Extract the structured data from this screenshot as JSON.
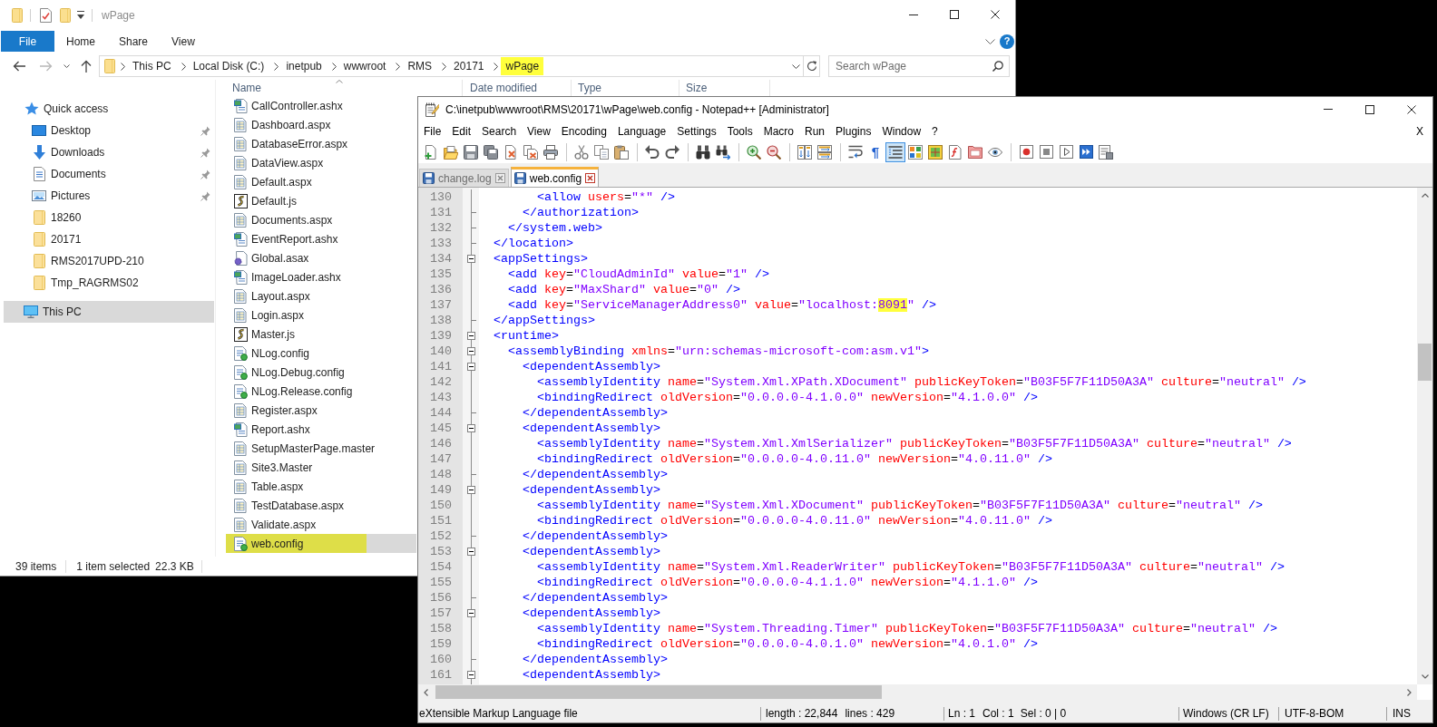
{
  "explorer": {
    "title": "wPage",
    "file_button": "File",
    "help_button": "?",
    "ribbon_tabs": [
      {
        "label": "Home",
        "selected": false
      },
      {
        "label": "Share",
        "selected": false
      },
      {
        "label": "View",
        "selected": false
      }
    ],
    "breadcrumbs": [
      {
        "label": "This PC",
        "highlighted": false
      },
      {
        "label": "Local Disk (C:)",
        "highlighted": false
      },
      {
        "label": "inetpub",
        "highlighted": false
      },
      {
        "label": "wwwroot",
        "highlighted": false
      },
      {
        "label": "RMS",
        "highlighted": false
      },
      {
        "label": "20171",
        "highlighted": false
      },
      {
        "label": "wPage",
        "highlighted": true
      }
    ],
    "search": {
      "placeholder": "Search wPage"
    },
    "nav": [
      {
        "label": "Quick access",
        "kind": "star",
        "selected": false,
        "children": [
          {
            "label": "Desktop",
            "kind": "desktop",
            "pinned": true,
            "selected": false
          },
          {
            "label": "Downloads",
            "kind": "downloads",
            "pinned": true,
            "selected": false
          },
          {
            "label": "Documents",
            "kind": "documents",
            "pinned": true,
            "selected": false
          },
          {
            "label": "Pictures",
            "kind": "pictures",
            "pinned": true,
            "selected": false
          },
          {
            "label": "18260",
            "kind": "folder",
            "pinned": false,
            "selected": false
          },
          {
            "label": "20171",
            "kind": "folder",
            "pinned": false,
            "selected": false
          },
          {
            "label": "RMS2017UPD-210",
            "kind": "folder",
            "pinned": false,
            "selected": false
          },
          {
            "label": "Tmp_RAGRMS02",
            "kind": "folder",
            "pinned": false,
            "selected": false
          }
        ]
      },
      {
        "label": "This PC",
        "kind": "pc",
        "selected": true
      }
    ],
    "columns": [
      {
        "label": "Name",
        "sorted": true
      },
      {
        "label": "Date modified",
        "sorted": false
      },
      {
        "label": "Type",
        "sorted": false
      },
      {
        "label": "Size",
        "sorted": false
      }
    ],
    "files": [
      {
        "name": "CallController.ashx",
        "kind": "handler",
        "selected": false,
        "highlighted": false
      },
      {
        "name": "Dashboard.aspx",
        "kind": "page",
        "selected": false,
        "highlighted": false
      },
      {
        "name": "DatabaseError.aspx",
        "kind": "page",
        "selected": false,
        "highlighted": false
      },
      {
        "name": "DataView.aspx",
        "kind": "page",
        "selected": false,
        "highlighted": false
      },
      {
        "name": "Default.aspx",
        "kind": "page",
        "selected": false,
        "highlighted": false
      },
      {
        "name": "Default.js",
        "kind": "script",
        "selected": false,
        "highlighted": false
      },
      {
        "name": "Documents.aspx",
        "kind": "page",
        "selected": false,
        "highlighted": false
      },
      {
        "name": "EventReport.ashx",
        "kind": "handler",
        "selected": false,
        "highlighted": false
      },
      {
        "name": "Global.asax",
        "kind": "gear",
        "selected": false,
        "highlighted": false
      },
      {
        "name": "ImageLoader.ashx",
        "kind": "handler",
        "selected": false,
        "highlighted": false
      },
      {
        "name": "Layout.aspx",
        "kind": "page",
        "selected": false,
        "highlighted": false
      },
      {
        "name": "Login.aspx",
        "kind": "page",
        "selected": false,
        "highlighted": false
      },
      {
        "name": "Master.js",
        "kind": "script",
        "selected": false,
        "highlighted": false
      },
      {
        "name": "NLog.config",
        "kind": "config",
        "selected": false,
        "highlighted": false
      },
      {
        "name": "NLog.Debug.config",
        "kind": "config",
        "selected": false,
        "highlighted": false
      },
      {
        "name": "NLog.Release.config",
        "kind": "config",
        "selected": false,
        "highlighted": false
      },
      {
        "name": "Register.aspx",
        "kind": "page",
        "selected": false,
        "highlighted": false
      },
      {
        "name": "Report.ashx",
        "kind": "handler",
        "selected": false,
        "highlighted": false
      },
      {
        "name": "SetupMasterPage.master",
        "kind": "page",
        "selected": false,
        "highlighted": false
      },
      {
        "name": "Site3.Master",
        "kind": "page",
        "selected": false,
        "highlighted": false
      },
      {
        "name": "Table.aspx",
        "kind": "page",
        "selected": false,
        "highlighted": false
      },
      {
        "name": "TestDatabase.aspx",
        "kind": "page",
        "selected": false,
        "highlighted": false
      },
      {
        "name": "Validate.aspx",
        "kind": "page",
        "selected": false,
        "highlighted": false
      },
      {
        "name": "web.config",
        "kind": "config",
        "selected": true,
        "highlighted": true
      }
    ],
    "status_bar": {
      "item_count": "39 items",
      "selection": "1 item selected",
      "size": "22.3 KB"
    }
  },
  "notepad": {
    "title": "C:\\inetpub\\wwwroot\\RMS\\20171\\wPage\\web.config - Notepad++ [Administrator]",
    "menu": [
      "File",
      "Edit",
      "Search",
      "View",
      "Encoding",
      "Language",
      "Settings",
      "Tools",
      "Macro",
      "Run",
      "Plugins",
      "Window",
      "?"
    ],
    "close_document": "X",
    "toolbar": [
      [
        {
          "kind": "new",
          "pressed": false
        },
        {
          "kind": "open",
          "pressed": false
        },
        {
          "kind": "save",
          "pressed": false
        },
        {
          "kind": "save-all",
          "pressed": false
        },
        {
          "kind": "close",
          "pressed": false
        },
        {
          "kind": "close-all",
          "pressed": false
        },
        {
          "kind": "print",
          "pressed": false
        }
      ],
      [
        {
          "kind": "cut",
          "pressed": false
        },
        {
          "kind": "copy",
          "pressed": false
        },
        {
          "kind": "paste",
          "pressed": false
        }
      ],
      [
        {
          "kind": "undo",
          "pressed": false
        },
        {
          "kind": "redo",
          "pressed": false
        }
      ],
      [
        {
          "kind": "find",
          "pressed": false
        },
        {
          "kind": "replace",
          "pressed": false
        }
      ],
      [
        {
          "kind": "zoom-in",
          "pressed": false
        },
        {
          "kind": "zoom-out",
          "pressed": false
        }
      ],
      [
        {
          "kind": "sync-vertical",
          "pressed": false
        },
        {
          "kind": "sync-horizontal",
          "pressed": false
        }
      ],
      [
        {
          "kind": "word-wrap",
          "pressed": false
        },
        {
          "kind": "show-all-chars",
          "text": "¶",
          "pressed": false
        },
        {
          "kind": "indent-guide",
          "pressed": true
        },
        {
          "kind": "language",
          "pressed": false
        },
        {
          "kind": "doc-map",
          "pressed": false
        },
        {
          "kind": "function-list",
          "pressed": false
        },
        {
          "kind": "folder-workspace",
          "pressed": false
        },
        {
          "kind": "monitoring",
          "pressed": false
        }
      ],
      [
        {
          "kind": "record",
          "pressed": false
        },
        {
          "kind": "stop",
          "pressed": false
        },
        {
          "kind": "play",
          "pressed": false
        },
        {
          "kind": "play-multiple",
          "pressed": false
        },
        {
          "kind": "save-macro",
          "pressed": false
        }
      ]
    ],
    "tabs": [
      {
        "label": "change.log",
        "selected": false
      },
      {
        "label": "web.config",
        "selected": true
      }
    ],
    "lines": [
      {
        "number": "130",
        "fold_start": false,
        "fold_end": false,
        "segments": [
          {
            "text": "      <allow users=\"*\" />",
            "highlighted": false
          }
        ]
      },
      {
        "number": "131",
        "fold_start": false,
        "fold_end": true,
        "segments": [
          {
            "text": "    </authorization>",
            "highlighted": false
          }
        ]
      },
      {
        "number": "132",
        "fold_start": false,
        "fold_end": true,
        "segments": [
          {
            "text": "  </system.web>",
            "highlighted": false
          }
        ]
      },
      {
        "number": "133",
        "fold_start": false,
        "fold_end": true,
        "segments": [
          {
            "text": "</location>",
            "highlighted": false
          }
        ]
      },
      {
        "number": "134",
        "fold_start": true,
        "fold_end": false,
        "segments": [
          {
            "text": "<appSettings>",
            "highlighted": false
          }
        ]
      },
      {
        "number": "135",
        "fold_start": false,
        "fold_end": false,
        "segments": [
          {
            "text": "  <add key=\"CloudAdminId\" value=\"1\" />",
            "highlighted": false
          }
        ]
      },
      {
        "number": "136",
        "fold_start": false,
        "fold_end": false,
        "segments": [
          {
            "text": "  <add key=\"MaxShard\" value=\"0\" />",
            "highlighted": false
          }
        ]
      },
      {
        "number": "137",
        "fold_start": false,
        "fold_end": false,
        "segments": [
          {
            "text": "  <add key=\"ServiceManagerAddress0\" value=\"localhost:",
            "highlighted": false
          },
          {
            "text": "8091",
            "highlighted": true
          },
          {
            "text": "\" />",
            "highlighted": false
          }
        ]
      },
      {
        "number": "138",
        "fold_start": false,
        "fold_end": true,
        "segments": [
          {
            "text": "</appSettings>",
            "highlighted": false
          }
        ]
      },
      {
        "number": "139",
        "fold_start": true,
        "fold_end": false,
        "segments": [
          {
            "text": "<runtime>",
            "highlighted": false
          }
        ]
      },
      {
        "number": "140",
        "fold_start": true,
        "fold_end": false,
        "segments": [
          {
            "text": "  <assemblyBinding xmlns=\"urn:schemas-microsoft-com:asm.v1\">",
            "highlighted": false
          }
        ]
      },
      {
        "number": "141",
        "fold_start": true,
        "fold_end": false,
        "segments": [
          {
            "text": "    <dependentAssembly>",
            "highlighted": false
          }
        ]
      },
      {
        "number": "142",
        "fold_start": false,
        "fold_end": false,
        "segments": [
          {
            "text": "      <assemblyIdentity name=\"System.Xml.XPath.XDocument\" publicKeyToken=\"B03F5F7F11D50A3A\" culture=\"neutral\" />",
            "highlighted": false
          }
        ]
      },
      {
        "number": "143",
        "fold_start": false,
        "fold_end": false,
        "segments": [
          {
            "text": "      <bindingRedirect oldVersion=\"0.0.0.0-4.1.0.0\" newVersion=\"4.1.0.0\" />",
            "highlighted": false
          }
        ]
      },
      {
        "number": "144",
        "fold_start": false,
        "fold_end": true,
        "segments": [
          {
            "text": "    </dependentAssembly>",
            "highlighted": false
          }
        ]
      },
      {
        "number": "145",
        "fold_start": true,
        "fold_end": false,
        "segments": [
          {
            "text": "    <dependentAssembly>",
            "highlighted": false
          }
        ]
      },
      {
        "number": "146",
        "fold_start": false,
        "fold_end": false,
        "segments": [
          {
            "text": "      <assemblyIdentity name=\"System.Xml.XmlSerializer\" publicKeyToken=\"B03F5F7F11D50A3A\" culture=\"neutral\" />",
            "highlighted": false
          }
        ]
      },
      {
        "number": "147",
        "fold_start": false,
        "fold_end": false,
        "segments": [
          {
            "text": "      <bindingRedirect oldVersion=\"0.0.0.0-4.0.11.0\" newVersion=\"4.0.11.0\" />",
            "highlighted": false
          }
        ]
      },
      {
        "number": "148",
        "fold_start": false,
        "fold_end": true,
        "segments": [
          {
            "text": "    </dependentAssembly>",
            "highlighted": false
          }
        ]
      },
      {
        "number": "149",
        "fold_start": true,
        "fold_end": false,
        "segments": [
          {
            "text": "    <dependentAssembly>",
            "highlighted": false
          }
        ]
      },
      {
        "number": "150",
        "fold_start": false,
        "fold_end": false,
        "segments": [
          {
            "text": "      <assemblyIdentity name=\"System.Xml.XDocument\" publicKeyToken=\"B03F5F7F11D50A3A\" culture=\"neutral\" />",
            "highlighted": false
          }
        ]
      },
      {
        "number": "151",
        "fold_start": false,
        "fold_end": false,
        "segments": [
          {
            "text": "      <bindingRedirect oldVersion=\"0.0.0.0-4.0.11.0\" newVersion=\"4.0.11.0\" />",
            "highlighted": false
          }
        ]
      },
      {
        "number": "152",
        "fold_start": false,
        "fold_end": true,
        "segments": [
          {
            "text": "    </dependentAssembly>",
            "highlighted": false
          }
        ]
      },
      {
        "number": "153",
        "fold_start": true,
        "fold_end": false,
        "segments": [
          {
            "text": "    <dependentAssembly>",
            "highlighted": false
          }
        ]
      },
      {
        "number": "154",
        "fold_start": false,
        "fold_end": false,
        "segments": [
          {
            "text": "      <assemblyIdentity name=\"System.Xml.ReaderWriter\" publicKeyToken=\"B03F5F7F11D50A3A\" culture=\"neutral\" />",
            "highlighted": false
          }
        ]
      },
      {
        "number": "155",
        "fold_start": false,
        "fold_end": false,
        "segments": [
          {
            "text": "      <bindingRedirect oldVersion=\"0.0.0.0-4.1.1.0\" newVersion=\"4.1.1.0\" />",
            "highlighted": false
          }
        ]
      },
      {
        "number": "156",
        "fold_start": false,
        "fold_end": true,
        "segments": [
          {
            "text": "    </dependentAssembly>",
            "highlighted": false
          }
        ]
      },
      {
        "number": "157",
        "fold_start": true,
        "fold_end": false,
        "segments": [
          {
            "text": "    <dependentAssembly>",
            "highlighted": false
          }
        ]
      },
      {
        "number": "158",
        "fold_start": false,
        "fold_end": false,
        "segments": [
          {
            "text": "      <assemblyIdentity name=\"System.Threading.Timer\" publicKeyToken=\"B03F5F7F11D50A3A\" culture=\"neutral\" />",
            "highlighted": false
          }
        ]
      },
      {
        "number": "159",
        "fold_start": false,
        "fold_end": false,
        "segments": [
          {
            "text": "      <bindingRedirect oldVersion=\"0.0.0.0-4.0.1.0\" newVersion=\"4.0.1.0\" />",
            "highlighted": false
          }
        ]
      },
      {
        "number": "160",
        "fold_start": false,
        "fold_end": true,
        "segments": [
          {
            "text": "    </dependentAssembly>",
            "highlighted": false
          }
        ]
      },
      {
        "number": "161",
        "fold_start": true,
        "fold_end": false,
        "segments": [
          {
            "text": "    <dependentAssembly>",
            "highlighted": false
          }
        ]
      }
    ],
    "status_bar": {
      "file_type": "eXtensible Markup Language file",
      "length": "length : 22,844",
      "lines": "lines : 429",
      "line": "Ln : 1",
      "column": "Col : 1",
      "selection": "Sel : 0 | 0",
      "eol": "Windows (CR LF)",
      "encoding": "UTF-8-BOM",
      "mode": "INS"
    }
  }
}
